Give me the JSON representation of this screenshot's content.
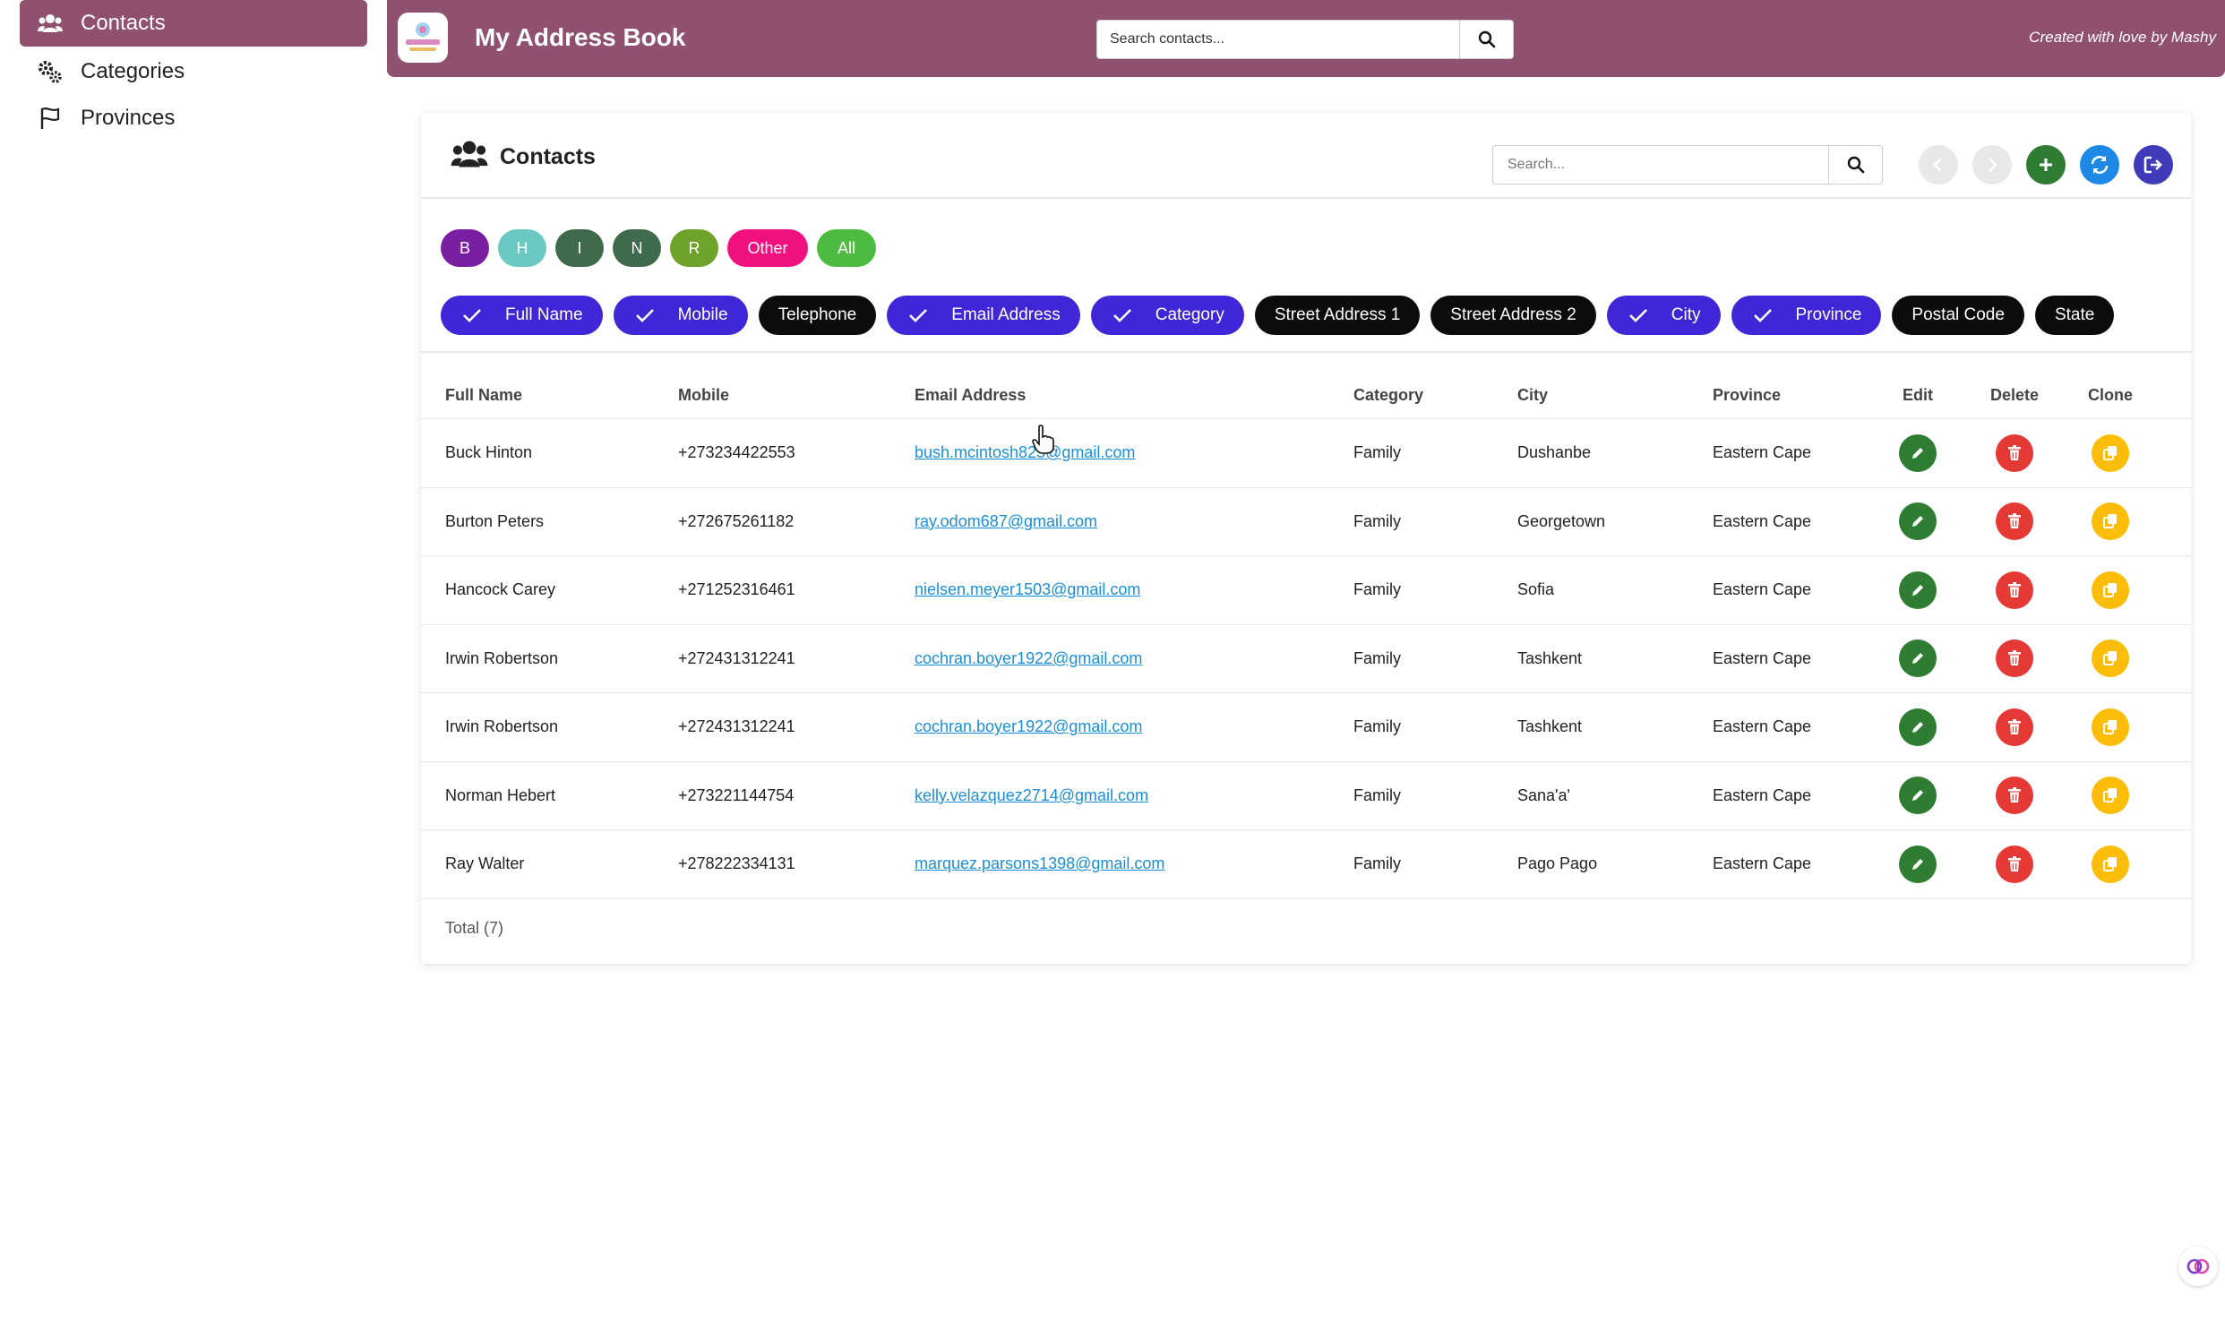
{
  "sidebar": {
    "items": [
      {
        "label": "Contacts",
        "icon": "users-icon",
        "active": true
      },
      {
        "label": "Categories",
        "icon": "gears-icon",
        "active": false
      },
      {
        "label": "Provinces",
        "icon": "flag-icon",
        "active": false
      }
    ]
  },
  "header": {
    "title": "My Address Book",
    "search_placeholder": "Search contacts...",
    "credit": "Created with love by Mashy",
    "bg_color": "#8f516f"
  },
  "card": {
    "title": "Contacts",
    "search_placeholder": "Search..."
  },
  "letter_filters": [
    {
      "label": "B",
      "color": "#7b1fa2"
    },
    {
      "label": "H",
      "color": "#6bc9c2"
    },
    {
      "label": "I",
      "color": "#3f6b4c"
    },
    {
      "label": "N",
      "color": "#3f6b4c"
    },
    {
      "label": "R",
      "color": "#6ea22b"
    },
    {
      "label": "Other",
      "color": "#f0117f"
    },
    {
      "label": "All",
      "color": "#4cbb3f"
    }
  ],
  "column_toggles": [
    {
      "label": "Full Name",
      "on": true
    },
    {
      "label": "Mobile",
      "on": true
    },
    {
      "label": "Telephone",
      "on": false
    },
    {
      "label": "Email Address",
      "on": true
    },
    {
      "label": "Category",
      "on": true
    },
    {
      "label": "Street Address 1",
      "on": false
    },
    {
      "label": "Street Address 2",
      "on": false
    },
    {
      "label": "City",
      "on": true
    },
    {
      "label": "Province",
      "on": true
    },
    {
      "label": "Postal Code",
      "on": false
    },
    {
      "label": "State",
      "on": false
    }
  ],
  "table": {
    "headers": [
      "Full Name",
      "Mobile",
      "Email Address",
      "Category",
      "City",
      "Province",
      "Edit",
      "Delete",
      "Clone"
    ],
    "rows": [
      {
        "name": "Buck Hinton",
        "mobile": "+273234422553",
        "email": "bush.mcintosh825@gmail.com",
        "category": "Family",
        "city": "Dushanbe",
        "province": "Eastern Cape"
      },
      {
        "name": "Burton Peters",
        "mobile": "+272675261182",
        "email": "ray.odom687@gmail.com",
        "category": "Family",
        "city": "Georgetown",
        "province": "Eastern Cape"
      },
      {
        "name": "Hancock Carey",
        "mobile": "+271252316461",
        "email": "nielsen.meyer1503@gmail.com",
        "category": "Family",
        "city": "Sofia",
        "province": "Eastern Cape"
      },
      {
        "name": "Irwin Robertson",
        "mobile": "+272431312241",
        "email": "cochran.boyer1922@gmail.com",
        "category": "Family",
        "city": "Tashkent",
        "province": "Eastern Cape"
      },
      {
        "name": "Irwin Robertson",
        "mobile": "+272431312241",
        "email": "cochran.boyer1922@gmail.com",
        "category": "Family",
        "city": "Tashkent",
        "province": "Eastern Cape"
      },
      {
        "name": "Norman Hebert",
        "mobile": "+273221144754",
        "email": "kelly.velazquez2714@gmail.com",
        "category": "Family",
        "city": "Sana'a'",
        "province": "Eastern Cape"
      },
      {
        "name": "Ray Walter",
        "mobile": "+278222334131",
        "email": "marquez.parsons1398@gmail.com",
        "category": "Family",
        "city": "Pago Pago",
        "province": "Eastern Cape"
      }
    ],
    "total": "Total (7)"
  }
}
